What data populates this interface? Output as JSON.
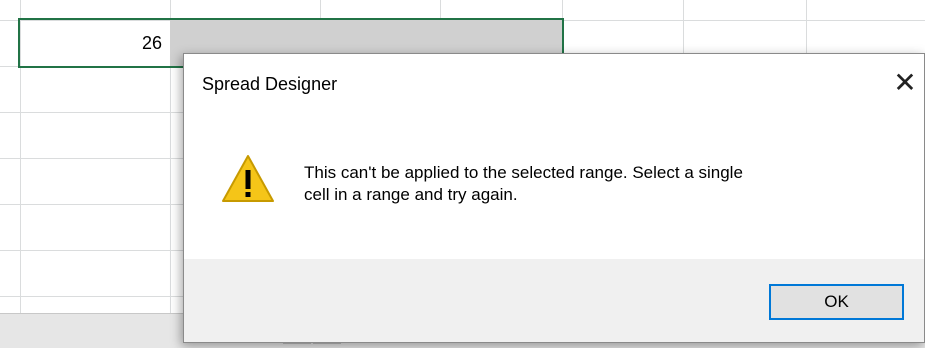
{
  "spreadsheet": {
    "cell_value": "26"
  },
  "dialog": {
    "title": "Spread Designer",
    "close_glyph": "✕",
    "icon": "warning-icon",
    "message_line1": " This can't be applied to the selected range. Select a single",
    "message_line2": "cell in a range and try again.",
    "ok_label": "OK"
  },
  "colors": {
    "selection_border": "#217346",
    "ok_focus_border": "#0078d7",
    "warning_fill": "#f5c518"
  }
}
